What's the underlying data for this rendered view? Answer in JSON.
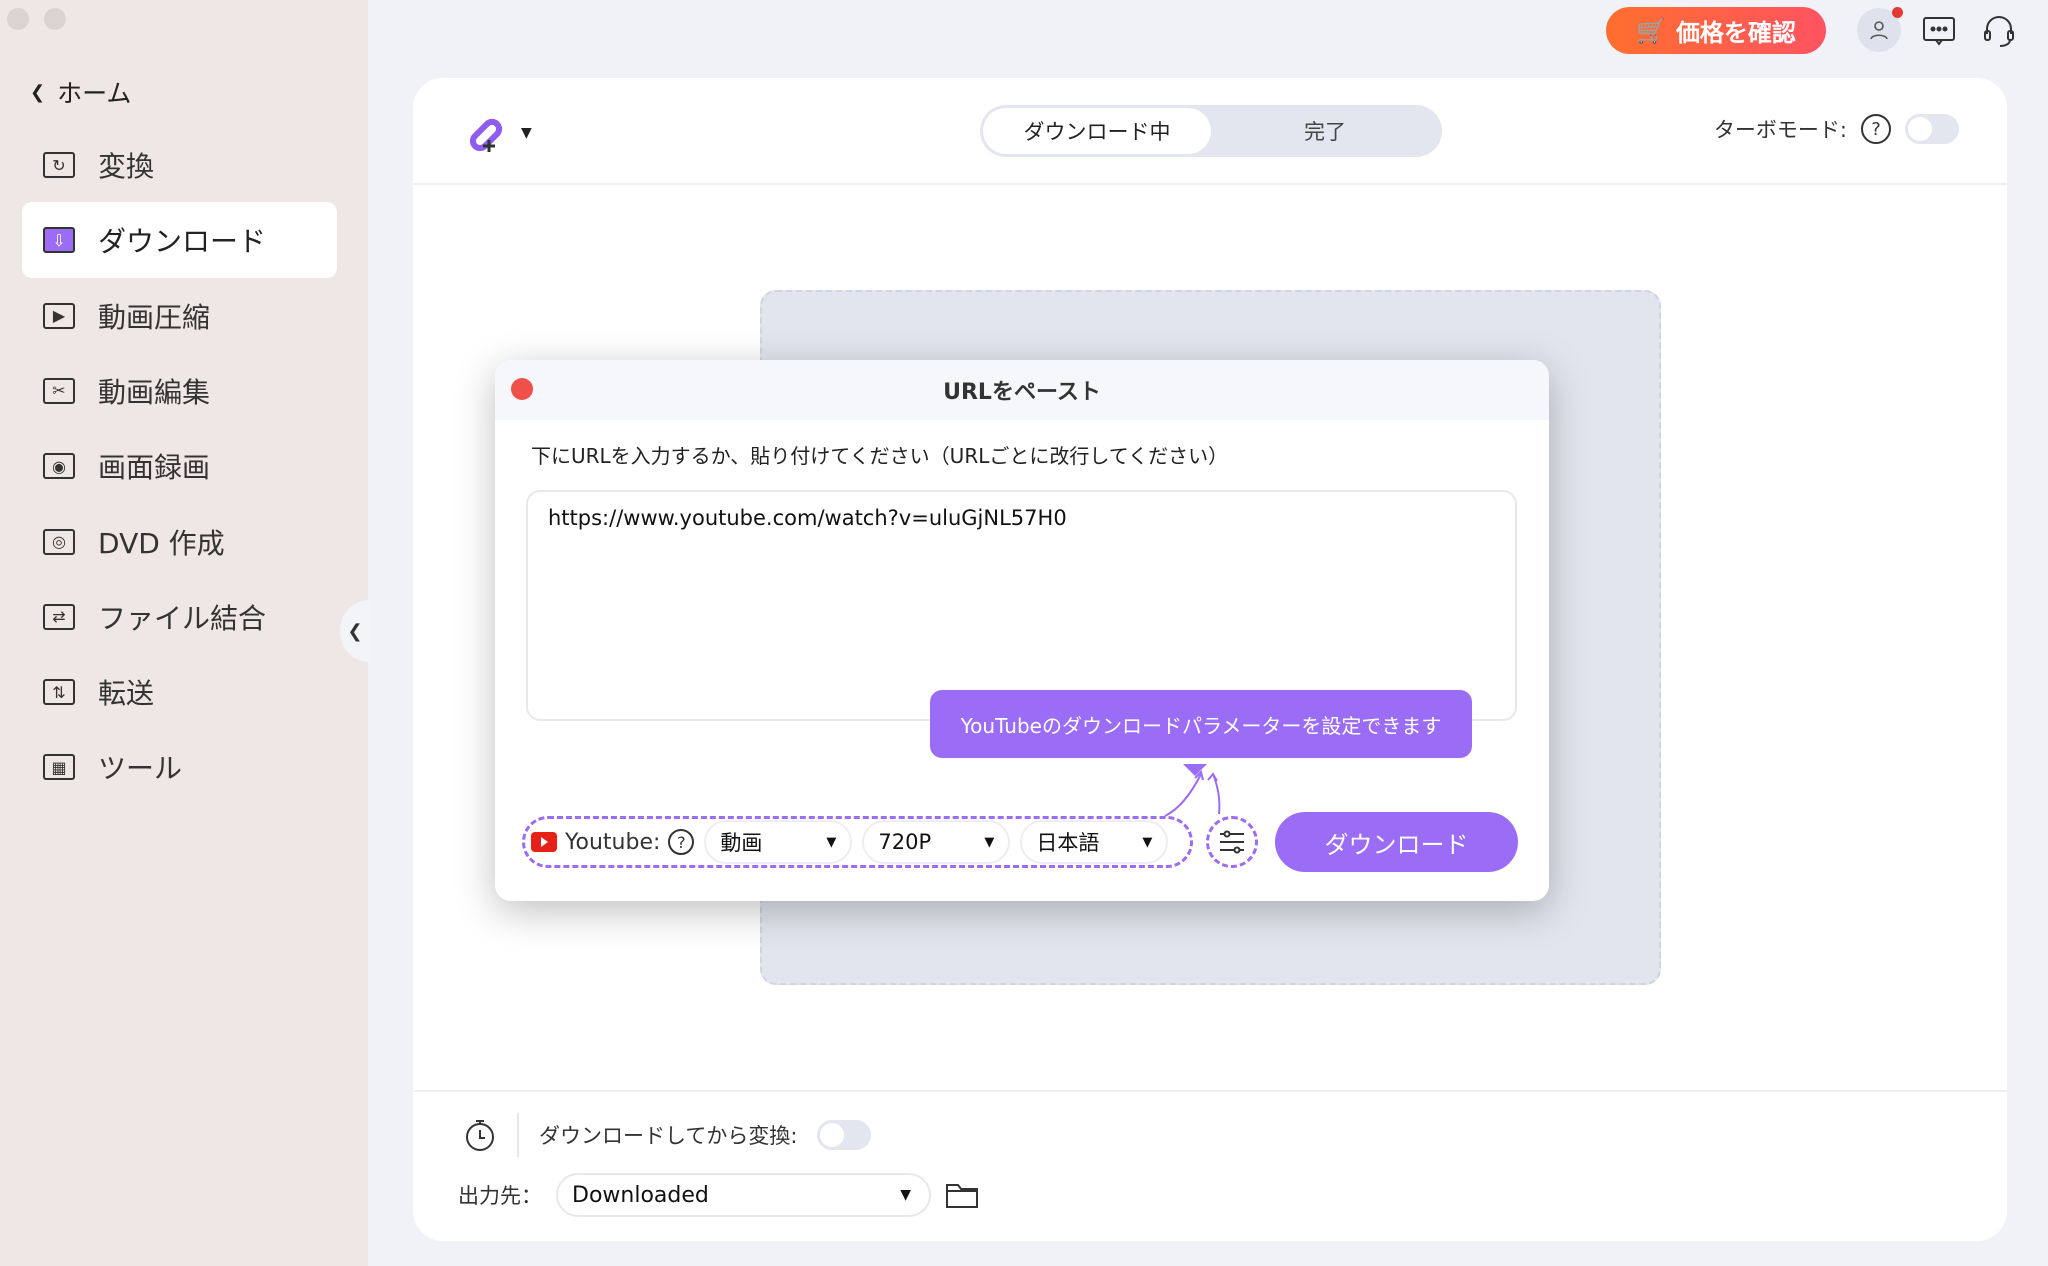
{
  "sidebar": {
    "home": "ホーム",
    "items": [
      {
        "label": "変換",
        "icon": "convert-icon"
      },
      {
        "label": "ダウンロード",
        "icon": "download-icon",
        "selected": true
      },
      {
        "label": "動画圧縮",
        "icon": "compress-icon"
      },
      {
        "label": "動画編集",
        "icon": "scissors-icon"
      },
      {
        "label": "画面録画",
        "icon": "screen-record-icon"
      },
      {
        "label": "DVD 作成",
        "icon": "dvd-icon"
      },
      {
        "label": "ファイル結合",
        "icon": "merge-icon"
      },
      {
        "label": "転送",
        "icon": "transfer-icon"
      },
      {
        "label": "ツール",
        "icon": "toolbox-icon"
      }
    ]
  },
  "topbar": {
    "price_label": "価格を確認",
    "accent": "#ff6330"
  },
  "header": {
    "tabs": [
      "ダウンロード中",
      "完了"
    ],
    "turbo_label": "ターボモード:",
    "turbo_on": false
  },
  "modal": {
    "title": "URLをペースト",
    "instruction": "下にURLを入力するか、貼り付けてください（URLごとに改行してください）",
    "url_value": "https://www.youtube.com/watch?v=uluGjNL57H0",
    "tooltip": "YouTubeのダウンロードパラメーターを設定できます",
    "source_label": "Youtube:",
    "type_value": "動画",
    "quality_value": "720P",
    "language_value": "日本語",
    "download_label": "ダウンロード",
    "accent": "#9b6cf5"
  },
  "footer": {
    "convert_label": "ダウンロードしてから変換:",
    "convert_on": false,
    "output_label": "出力先：",
    "output_value": "Downloaded"
  }
}
